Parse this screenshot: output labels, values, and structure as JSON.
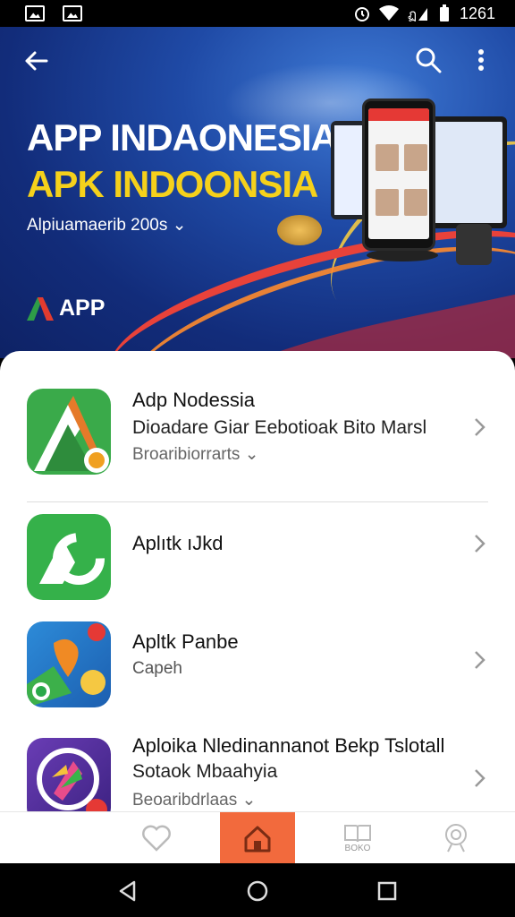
{
  "status_bar": {
    "time": "1261"
  },
  "hero": {
    "title": "APP INDAONESIA",
    "subtitle": "APK INDOONSIA",
    "tagline": "Alpiuamaerib 200s",
    "brand": "APP"
  },
  "apps": [
    {
      "title": "Adp Nodessia",
      "description": "Dioadare Giar Eebotioak Bito Marsl",
      "meta": "Broaribiorrarts",
      "icon": "green-triangle-app-icon"
    },
    {
      "title": "Aplıtk ıJkd",
      "description": "",
      "meta": "",
      "icon": "green-a-app-icon"
    },
    {
      "title": "Apltk Panbe",
      "description": "",
      "meta": "Capeh",
      "icon": "blue-map-app-icon"
    },
    {
      "title": "Aploika Nledinannanot Bekp Tslotall",
      "description": "Sotaok Mbaahyia",
      "meta": "Beoaribdrlaas",
      "icon": "purple-shield-app-icon"
    }
  ],
  "bottom_nav": {
    "items": [
      {
        "name": "favorites",
        "label": ""
      },
      {
        "name": "home",
        "label": ""
      },
      {
        "name": "books",
        "label": "BOKO"
      },
      {
        "name": "profile",
        "label": ""
      }
    ]
  },
  "colors": {
    "accent": "#f26a3d",
    "hero_bg": "#1a3d96",
    "hero_yellow": "#f5d11b"
  }
}
